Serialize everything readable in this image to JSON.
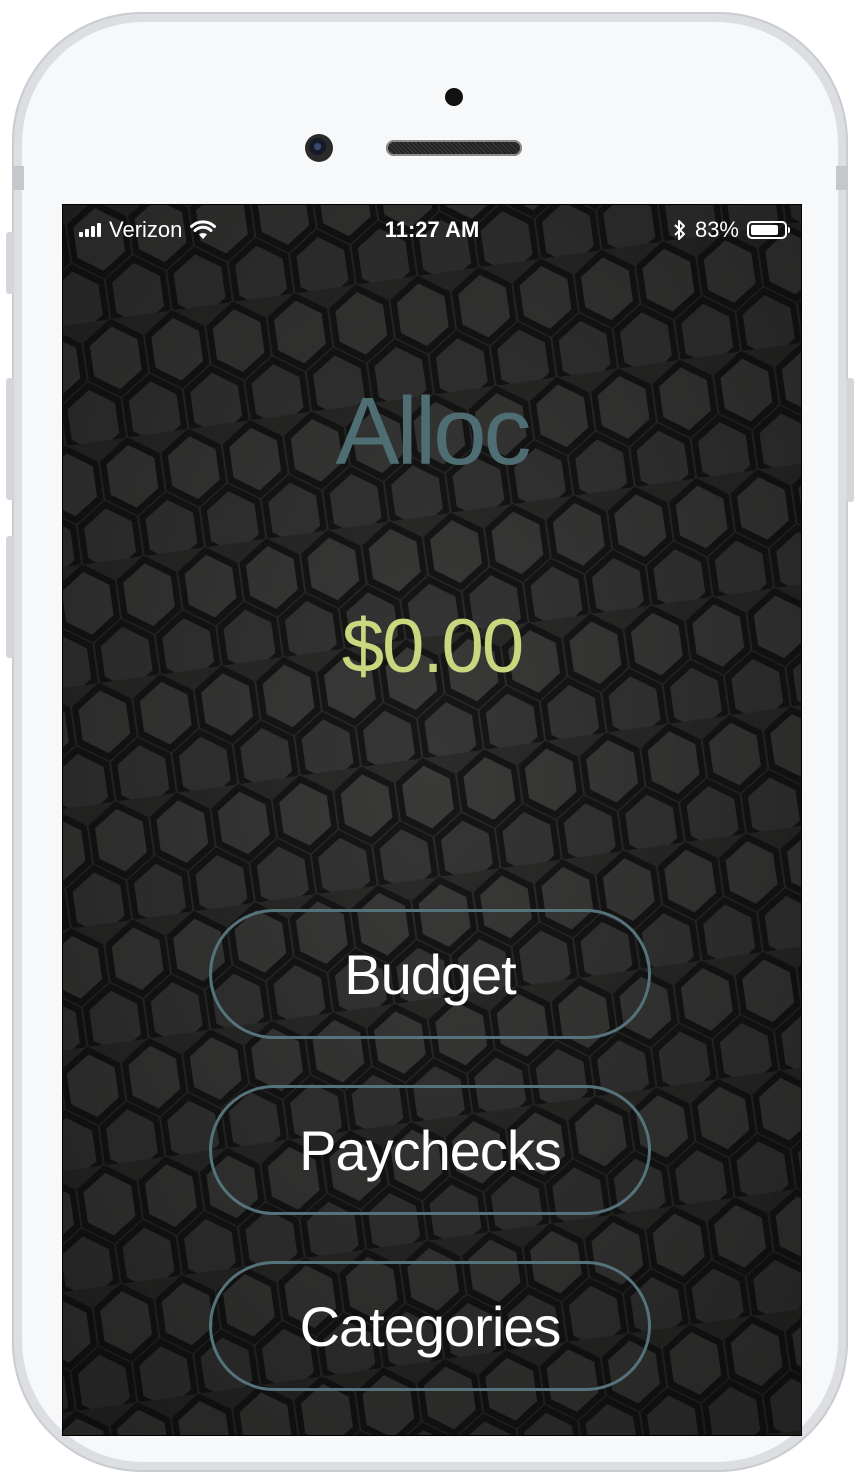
{
  "status_bar": {
    "carrier": "Verizon",
    "time": "11:27 AM",
    "battery_percent": "83%",
    "battery_level": 0.83,
    "icons": [
      "signal-bars-icon",
      "wifi-icon",
      "bluetooth-icon",
      "battery-icon"
    ]
  },
  "app": {
    "title": "Alloc",
    "balance": "$0.00"
  },
  "menu": {
    "budget_label": "Budget",
    "paychecks_label": "Paychecks",
    "categories_label": "Categories"
  },
  "colors": {
    "background": "#2b2b2a",
    "title": "#4f6e73",
    "balance": "#c9d77f",
    "button_border": "#55737a",
    "button_text": "#ffffff"
  }
}
